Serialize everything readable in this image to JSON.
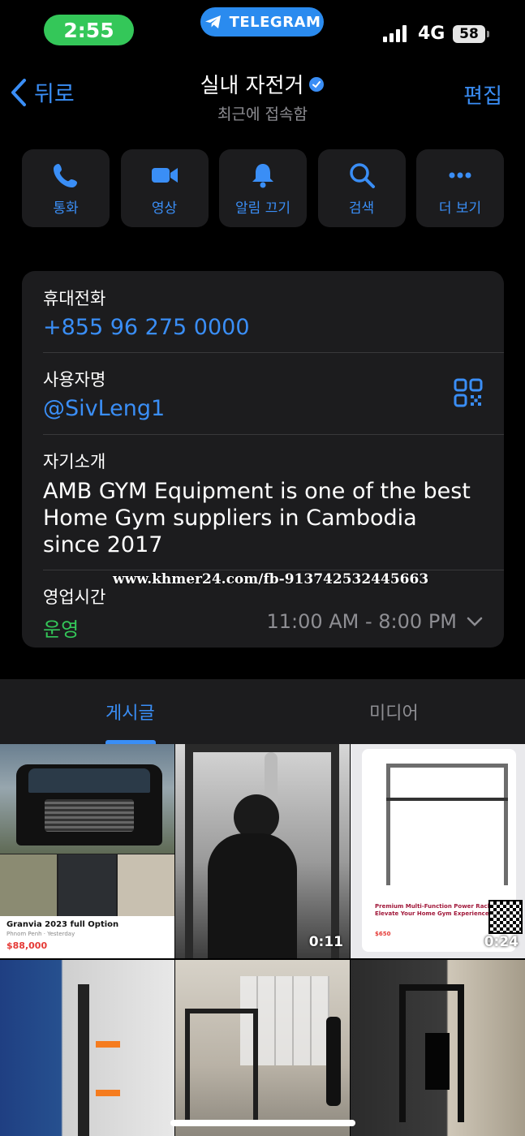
{
  "status_bar": {
    "time": "2:55",
    "app_pill": "TELEGRAM",
    "network": "4G",
    "battery": "58"
  },
  "header": {
    "back_label": "뒤로",
    "title": "실내 자전거",
    "subtitle": "최근에 접속함",
    "edit_label": "편집"
  },
  "actions": [
    {
      "label": "통화",
      "icon": "phone-icon"
    },
    {
      "label": "영상",
      "icon": "video-camera-icon"
    },
    {
      "label": "알림 끄기",
      "icon": "bell-icon"
    },
    {
      "label": "검색",
      "icon": "search-icon"
    },
    {
      "label": "더 보기",
      "icon": "more-dots-icon"
    }
  ],
  "info": {
    "phone_label": "휴대전화",
    "phone_value": "+855 96 275 0000",
    "username_label": "사용자명",
    "username_value": "@SivLeng1",
    "bio_label": "자기소개",
    "bio_value": "AMB GYM Equipment is one of the best Home Gym suppliers in Cambodia since 2017",
    "hours_label": "영업시간",
    "hours_status": "운영",
    "hours_value": "11:00 AM - 8:00 PM",
    "watermark": "www.khmer24.com/fb-913742532445663"
  },
  "tabs": {
    "posts": "게시글",
    "media": "미디어"
  },
  "media": [
    {
      "kind": "van",
      "title": "Granvia 2023 full Option",
      "sub": "Phnom Penh · Yesterday",
      "price": "$88,000"
    },
    {
      "kind": "gym-bw",
      "duration": "0:11"
    },
    {
      "kind": "rack",
      "title": "Premium Multi-Function Power Rack - Elevate Your Home Gym Experience!",
      "price": "$650",
      "duration": "0:24"
    },
    {
      "kind": "gym-blue"
    },
    {
      "kind": "gym-white"
    },
    {
      "kind": "gym-dark"
    }
  ],
  "colors": {
    "accent": "#3a8ef6",
    "green": "#34c759",
    "card": "#1c1c1e"
  }
}
